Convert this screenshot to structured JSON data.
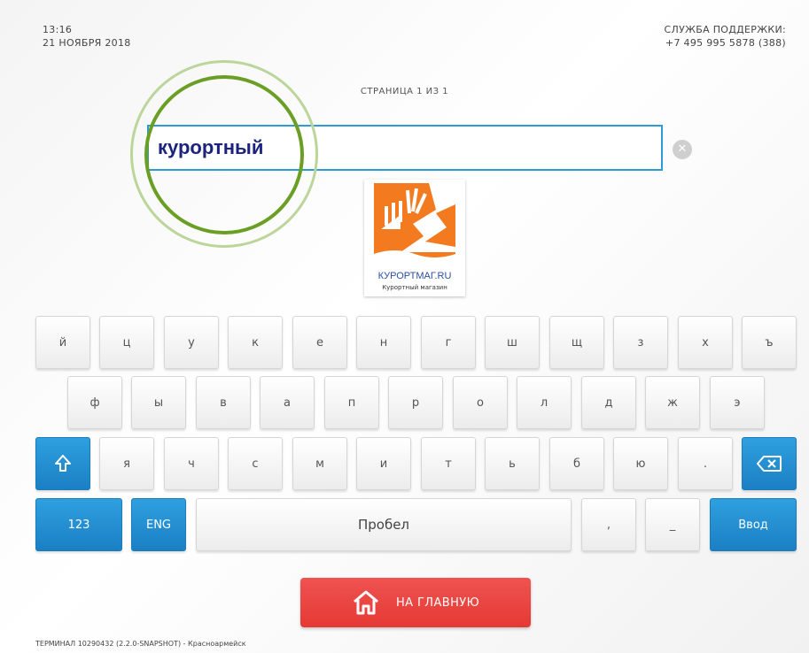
{
  "header": {
    "time": "13:16",
    "date": "21 НОЯБРЯ 2018",
    "support_label": "СЛУЖБА ПОДДЕРЖКИ:",
    "support_phone": "+7 495 995 5878 (388)"
  },
  "page_info": "СТРАНИЦА 1 ИЗ 1",
  "search": {
    "value": "курортный",
    "clear_icon": "clear-icon"
  },
  "result": {
    "brand": "КУРОРТМАГ.RU",
    "caption": "Курортный магазин"
  },
  "keyboard": {
    "row1": [
      "й",
      "ц",
      "у",
      "к",
      "е",
      "н",
      "г",
      "ш",
      "щ",
      "з",
      "х",
      "ъ"
    ],
    "row2": [
      "ф",
      "ы",
      "в",
      "а",
      "п",
      "р",
      "о",
      "л",
      "д",
      "ж",
      "э"
    ],
    "row3": [
      "я",
      "ч",
      "с",
      "м",
      "и",
      "т",
      "ь",
      "б",
      "ю",
      "."
    ],
    "shift_icon": "shift-arrow-icon",
    "backspace_icon": "backspace-icon",
    "numbers_label": "123",
    "lang_label": "ENG",
    "space_label": "Пробел",
    "comma": ",",
    "dash": "_",
    "enter_label": "Ввод"
  },
  "home_button": {
    "label": "НА ГЛАВНУЮ",
    "icon": "home-icon"
  },
  "footer": "ТЕРМИНАЛ 10290432 (2.2.0-SNAPSHOT) - Красноармейск",
  "colors": {
    "accent_blue": "#1b7fc4",
    "home_red": "#e53935",
    "highlight_green": "#6a9e24"
  }
}
